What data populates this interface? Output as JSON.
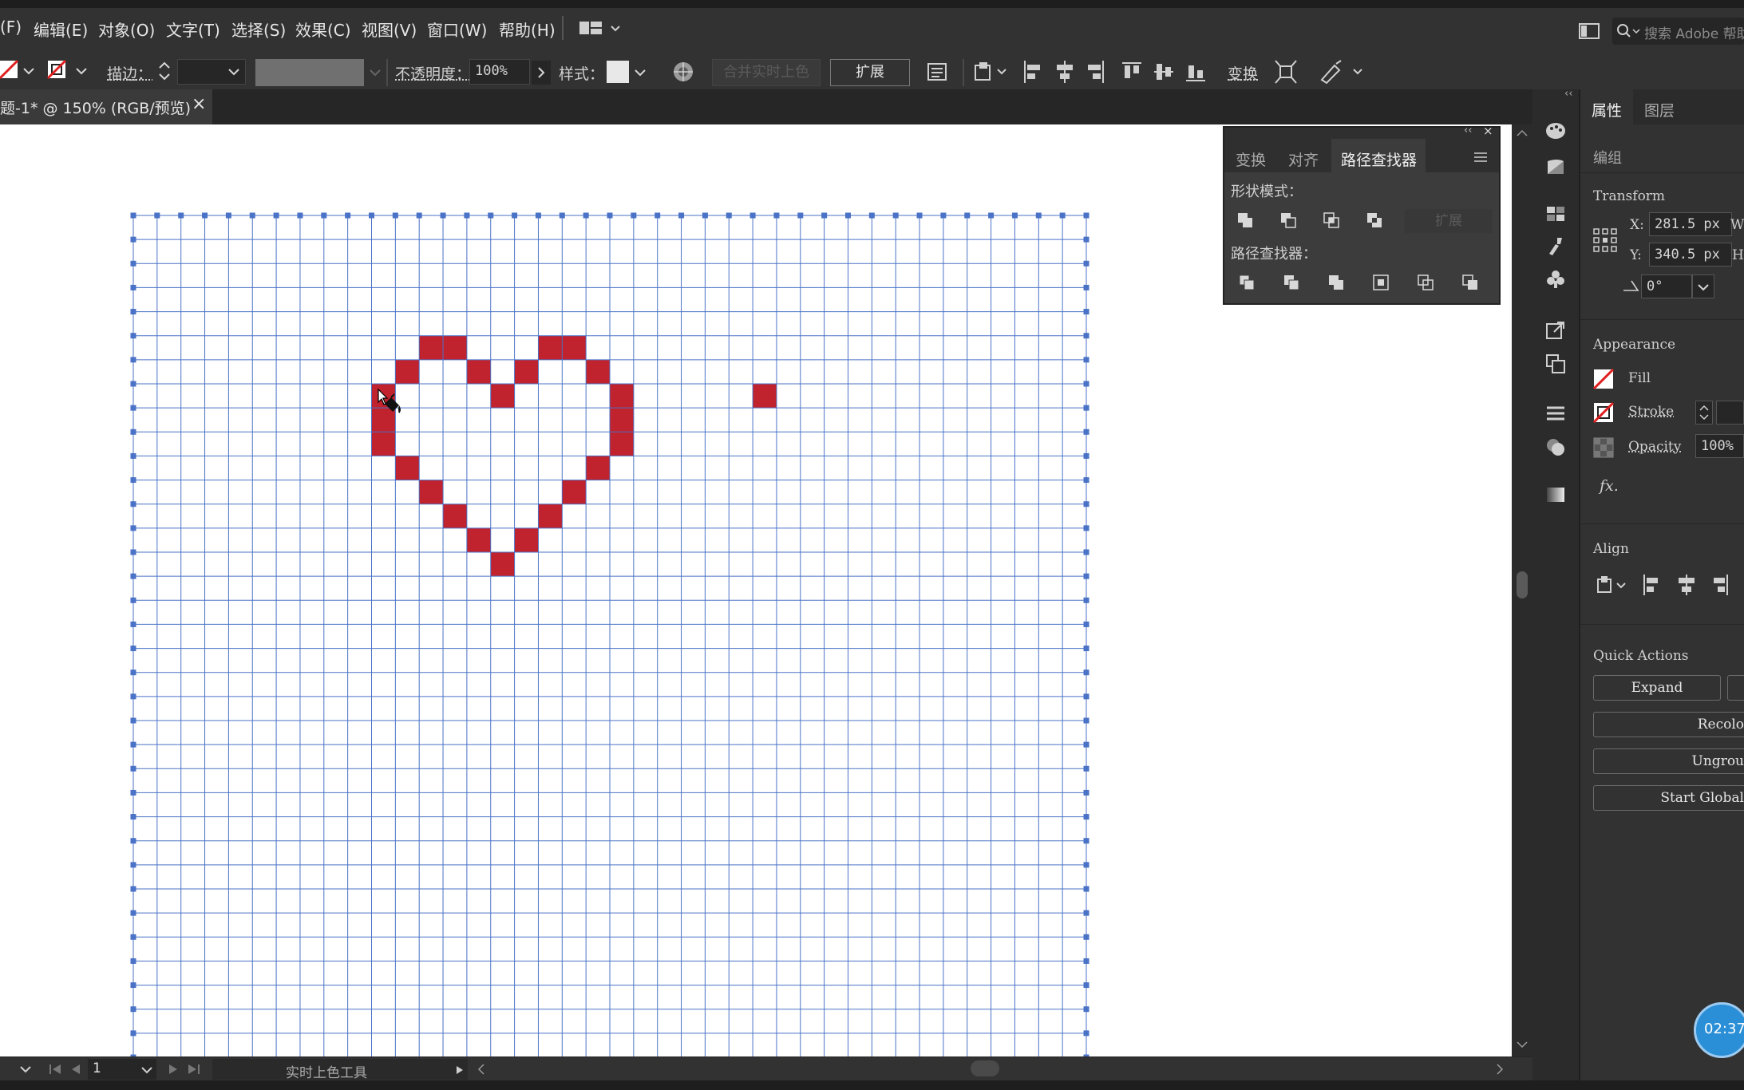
{
  "menubar": {
    "items": [
      "(F)",
      "编辑(E)",
      "对象(O)",
      "文字(T)",
      "选择(S)",
      "效果(C)",
      "视图(V)",
      "窗口(W)",
      "帮助(H)"
    ],
    "search_placeholder": "搜索 Adobe 帮助"
  },
  "control_bar": {
    "stroke_label": "描边：",
    "opacity_label": "不透明度：",
    "opacity_value": "100%",
    "style_label": "样式：",
    "merge_live_paint_label": "合并实时上色",
    "expand_label": "扩展",
    "transform_label": "变换"
  },
  "document": {
    "tab_title": "题-1* @ 150% (RGB/预览)",
    "close_glyph": "×"
  },
  "canvas": {
    "grid_columns": 41,
    "grid_rows": 36,
    "line_color": "#4a72c6",
    "fill_color": "#c0222e",
    "filled_cells": [
      [
        12,
        5
      ],
      [
        13,
        5
      ],
      [
        17,
        5
      ],
      [
        18,
        5
      ],
      [
        11,
        6
      ],
      [
        14,
        6
      ],
      [
        16,
        6
      ],
      [
        19,
        6
      ],
      [
        10,
        7
      ],
      [
        15,
        7
      ],
      [
        20,
        7
      ],
      [
        26,
        7
      ],
      [
        10,
        8
      ],
      [
        20,
        8
      ],
      [
        10,
        9
      ],
      [
        20,
        9
      ],
      [
        11,
        10
      ],
      [
        19,
        10
      ],
      [
        12,
        11
      ],
      [
        18,
        11
      ],
      [
        13,
        12
      ],
      [
        17,
        12
      ],
      [
        14,
        13
      ],
      [
        16,
        13
      ],
      [
        15,
        14
      ]
    ]
  },
  "float_panel": {
    "tabs": [
      "变换",
      "对齐",
      "路径查找器"
    ],
    "active_tab": "路径查找器",
    "shape_modes_label": "形状模式：",
    "expand_label": "扩展",
    "pathfinders_label": "路径查找器："
  },
  "properties_panel": {
    "tabs": [
      "属性",
      "图层"
    ],
    "group_label": "编组",
    "transform_title": "Transform",
    "x_label": "X:",
    "x_value": "281.5 px",
    "y_label": "Y:",
    "y_value": "340.5 px",
    "w_label": "W",
    "h_label": "H",
    "angle_value": "0°",
    "appearance_title": "Appearance",
    "fill_label": "Fill",
    "stroke_label": "Stroke",
    "opacity_label": "Opacity",
    "opacity_value": "100%",
    "fx_label": "fx.",
    "align_title": "Align",
    "quick_actions_title": "Quick Actions",
    "expand_button": "Expand",
    "recolor_button": "Recolo",
    "ungroup_button": "Ungrou",
    "start_global_button": "Start Global"
  },
  "status_bar": {
    "page_number": "1",
    "tool_name": "实时上色工具"
  },
  "timer": "02:37",
  "colors": {
    "ui_dark": "#323232",
    "accent_blue": "#2a8fd6",
    "heart_red": "#c0222e",
    "selection_blue": "#4a72c6"
  }
}
